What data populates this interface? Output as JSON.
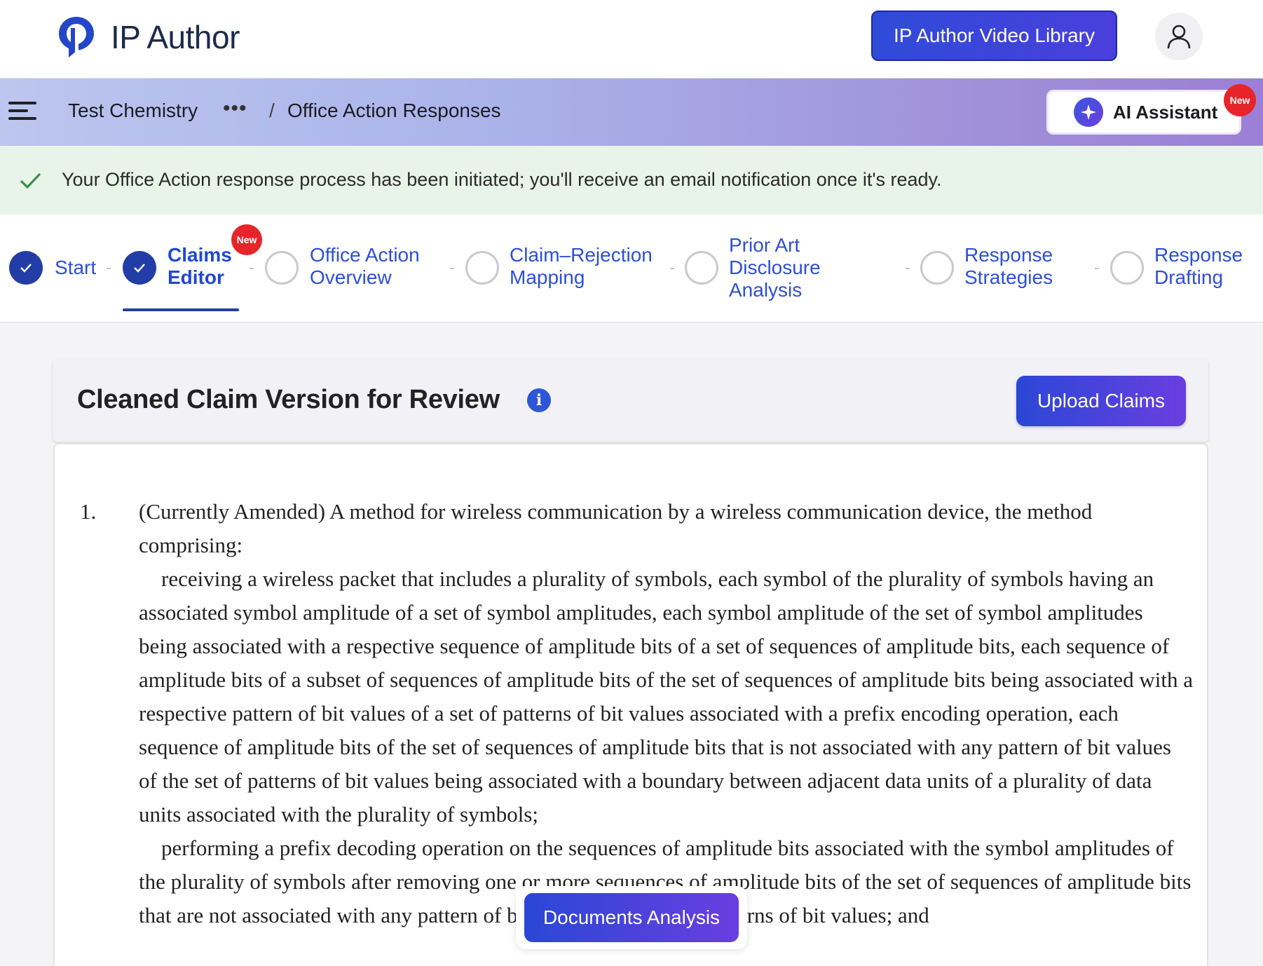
{
  "app": {
    "name": "IP Author"
  },
  "header": {
    "video_library_label": "IP Author Video Library"
  },
  "breadcrumb": {
    "project": "Test Chemistry",
    "more": "•••",
    "separator": "/",
    "current": "Office Action Responses"
  },
  "ai_assistant": {
    "label": "AI Assistant",
    "badge": "New"
  },
  "banner": {
    "message": "Your Office Action response process has been initiated; you'll receive an email notification once it's ready."
  },
  "steps": [
    {
      "line1": "Start",
      "line2": "",
      "line3": "",
      "status": "done"
    },
    {
      "line1": "Claims",
      "line2": "Editor",
      "line3": "",
      "status": "done",
      "active": true,
      "badge": "New"
    },
    {
      "line1": "Office Action",
      "line2": "Overview",
      "line3": "",
      "status": "todo"
    },
    {
      "line1": "Claim–Rejection",
      "line2": "Mapping",
      "line3": "",
      "status": "todo"
    },
    {
      "line1": "Prior Art",
      "line2": "Disclosure",
      "line3": "Analysis",
      "status": "todo"
    },
    {
      "line1": "Response",
      "line2": "Strategies",
      "line3": "",
      "status": "todo"
    },
    {
      "line1": "Response",
      "line2": "Drafting",
      "line3": "",
      "status": "todo"
    }
  ],
  "card": {
    "title": "Cleaned Claim Version for Review",
    "upload_label": "Upload Claims"
  },
  "claim": {
    "number": "1.",
    "intro": "(Currently Amended) A method for wireless communication by a wireless communication device, the method comprising:",
    "para1": "receiving a wireless packet that includes a plurality of symbols, each symbol of the plurality of symbols having an associated symbol amplitude of a set of symbol amplitudes, each symbol amplitude of the set of symbol amplitudes being associated with a respective sequence of amplitude bits of a set of sequences of amplitude bits, each sequence of amplitude bits of a subset of sequences of amplitude bits of the set of sequences of amplitude bits being associated with a respective pattern of bit values of a set of patterns of bit values associated with a prefix encoding operation, each sequence of amplitude bits of the set of sequences of amplitude bits that is not associated with any pattern of bit values of the set of patterns of bit values being associated with a boundary between adjacent data units of a plurality of data units associated with the plurality of symbols;",
    "para2": "performing a prefix decoding operation on the sequences of amplitude bits associated with the symbol amplitudes of the plurality of symbols after removing one or more sequences of amplitude bits of the set of sequences of amplitude bits that are not associated with any pattern of bit values of the set of patterns of bit values; and"
  },
  "floating": {
    "documents_analysis_label": "Documents Analysis"
  },
  "colors": {
    "primary": "#233da6",
    "accent_gradient_start": "#2a47d6",
    "accent_gradient_end": "#6a3ee0",
    "success_bg": "#e8f3ea",
    "badge_red": "#e8242b"
  }
}
